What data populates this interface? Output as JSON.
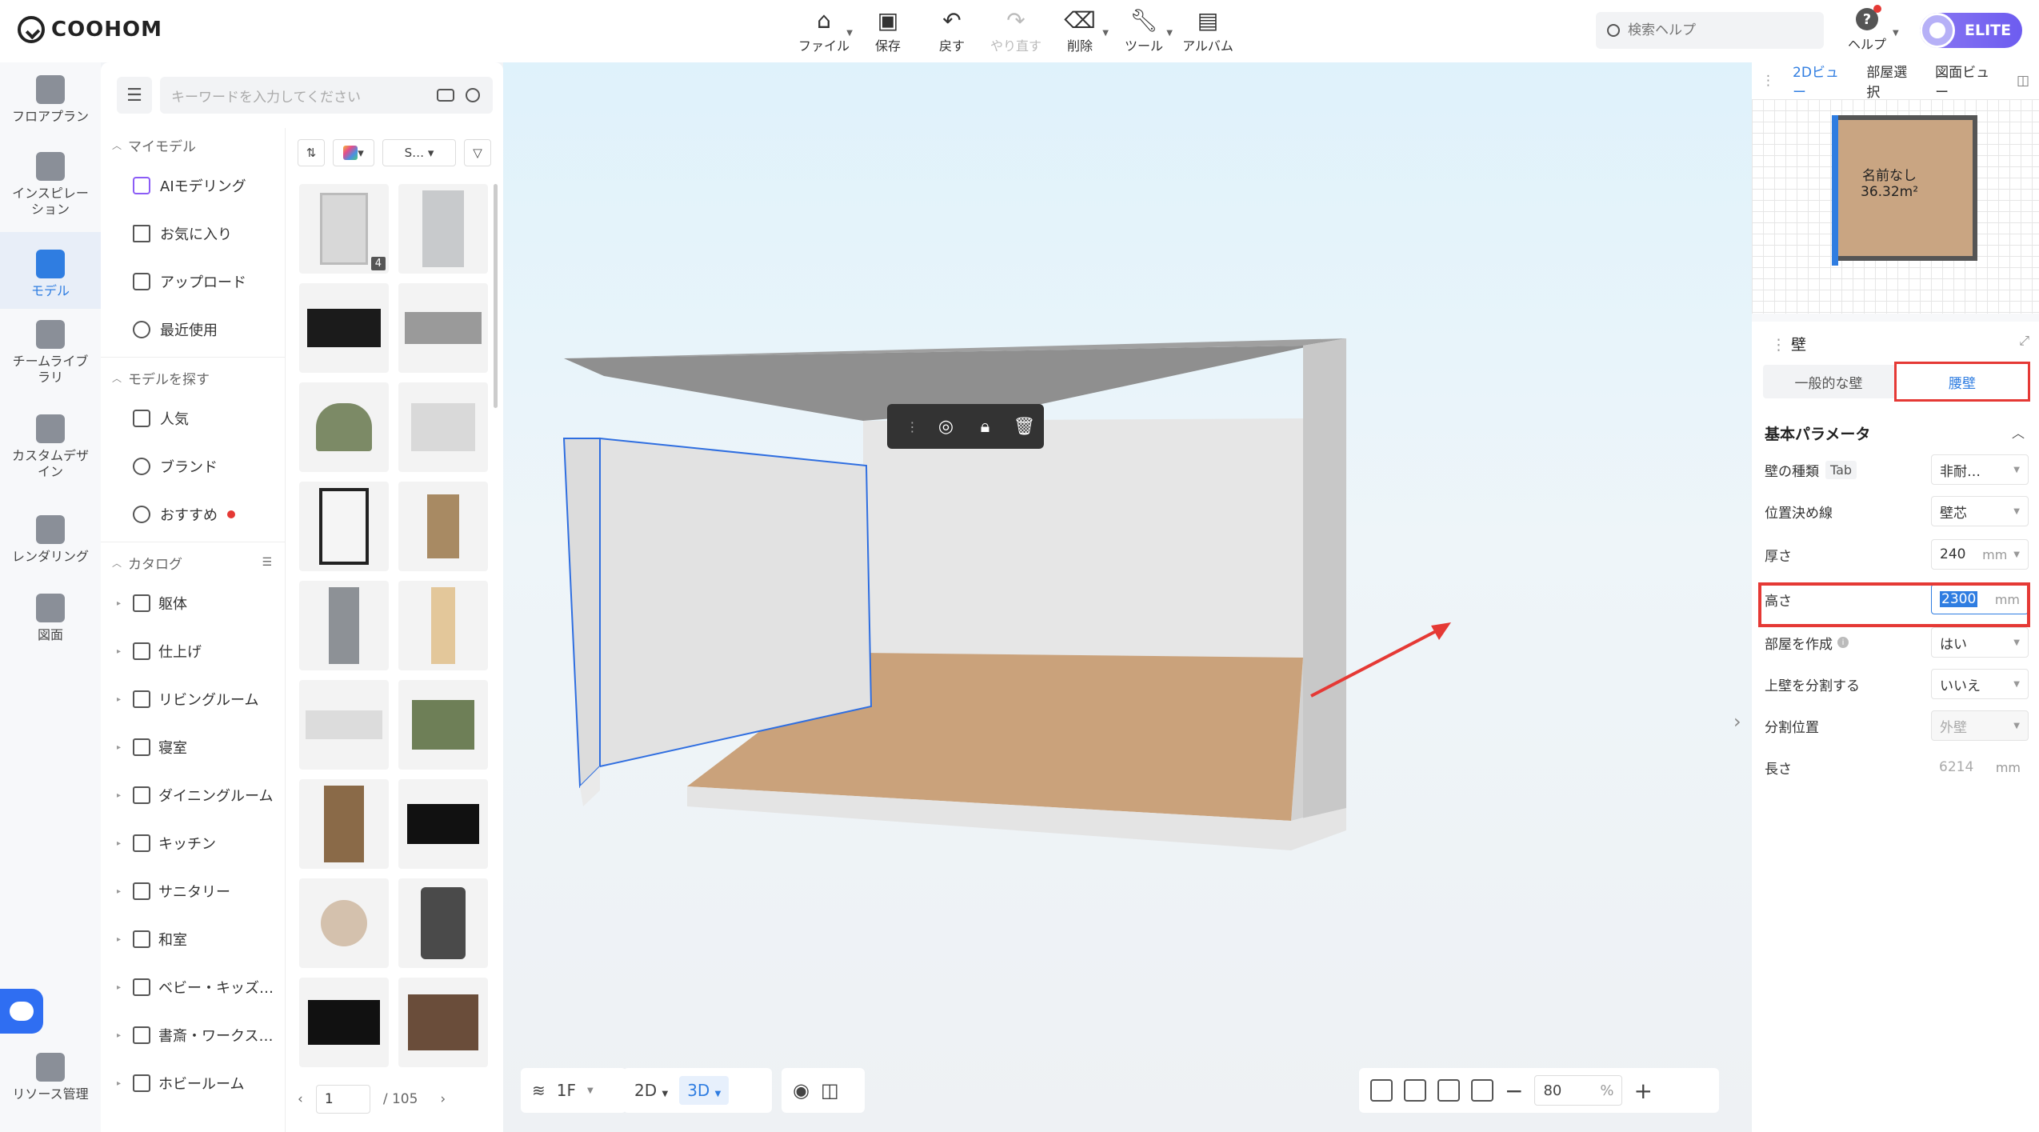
{
  "app": {
    "logo_text": "COOHOM"
  },
  "toolbar": {
    "file": "ファイル",
    "save": "保存",
    "undo": "戻す",
    "redo": "やり直す",
    "delete": "削除",
    "tools": "ツール",
    "album": "アルバム"
  },
  "search": {
    "placeholder": "検索ヘルプ"
  },
  "help": {
    "label": "ヘルプ"
  },
  "account": {
    "badge": "ELITE"
  },
  "leftnav": {
    "items": [
      {
        "label": "フロアプラン"
      },
      {
        "label": "インスピレーション"
      },
      {
        "label": "モデル"
      },
      {
        "label": "チームライブラリ"
      },
      {
        "label": "カスタムデザイン"
      },
      {
        "label": "レンダリング"
      },
      {
        "label": "図面"
      },
      {
        "label": "リソース管理"
      }
    ]
  },
  "model_panel": {
    "search_placeholder": "キーワードを入力してください",
    "my_models_header": "マイモデル",
    "my_models": [
      "AIモデリング",
      "お気に入り",
      "アップロード",
      "最近使用"
    ],
    "explore_header": "モデルを探す",
    "explore": [
      "人気",
      "ブランド",
      "おすすめ"
    ],
    "catalog_header": "カタログ",
    "catalog": [
      "躯体",
      "仕上げ",
      "リビングルーム",
      "寝室",
      "ダイニングルーム",
      "キッチン",
      "サニタリー",
      "和室",
      "ベビー・キッズ…",
      "書斎・ワークス…",
      "ホビールーム"
    ],
    "filter_style": "S…",
    "thumb_badge": "4",
    "page_current": "1",
    "page_total": "/ 105"
  },
  "viewport": {
    "floor": "1F",
    "view_2d": "2D",
    "view_3d": "3D",
    "zoom_value": "80",
    "zoom_unit": "%"
  },
  "right_panel": {
    "tabs": [
      "2Dビュー",
      "部屋選択",
      "図面ビュー"
    ],
    "room_name": "名前なし",
    "room_area": "36.32m²",
    "section_title": "壁",
    "segment_options": [
      "一般的な壁",
      "腰壁"
    ],
    "basic_params": "基本パラメータ",
    "params": [
      {
        "label": "壁の種類",
        "tag": "Tab",
        "value": "非耐…"
      },
      {
        "label": "位置決め線",
        "value": "壁芯"
      },
      {
        "label": "厚さ",
        "value": "240",
        "unit": "mm"
      },
      {
        "label": "高さ",
        "value": "2300",
        "unit": "mm"
      },
      {
        "label": "部屋を作成",
        "value": "はい"
      },
      {
        "label": "上壁を分割する",
        "value": "いいえ"
      },
      {
        "label": "分割位置",
        "value": "外壁"
      },
      {
        "label": "長さ",
        "value": "6214",
        "unit": "mm"
      }
    ]
  }
}
